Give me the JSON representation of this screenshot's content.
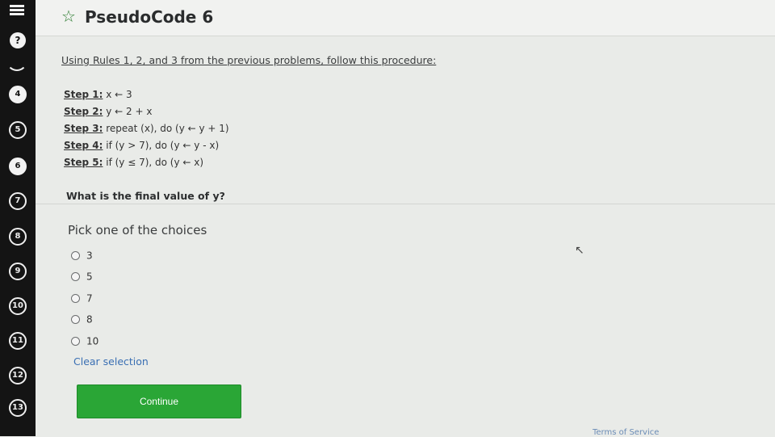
{
  "sidebar": {
    "help_label": "?",
    "items": [
      {
        "label": "4",
        "filled": true
      },
      {
        "label": "5",
        "filled": false
      },
      {
        "label": "6",
        "filled": true
      },
      {
        "label": "7",
        "filled": false
      },
      {
        "label": "8",
        "filled": false
      },
      {
        "label": "9",
        "filled": false
      },
      {
        "label": "10",
        "filled": false
      },
      {
        "label": "11",
        "filled": false
      },
      {
        "label": "12",
        "filled": false
      },
      {
        "label": "13",
        "filled": false
      }
    ]
  },
  "header": {
    "title": "PseudoCode 6",
    "star_icon": "star-outline-icon"
  },
  "problem": {
    "intro": "Using Rules 1, 2, and 3 from the previous problems, follow this procedure:",
    "steps": [
      {
        "label": "Step 1:",
        "text": " x ← 3"
      },
      {
        "label": "Step 2:",
        "text": " y ← 2 + x"
      },
      {
        "label": "Step 3:",
        "text": " repeat (x), do (y ← y + 1)"
      },
      {
        "label": "Step 4:",
        "text": " if (y > 7), do (y ← y - x)"
      },
      {
        "label": "Step 5:",
        "text": " if (y ≤ 7), do (y ← x)"
      }
    ],
    "question": "What is the final value of y?"
  },
  "answer": {
    "prompt": "Pick one of the choices",
    "choices": [
      "3",
      "5",
      "7",
      "8",
      "10"
    ],
    "clear_label": "Clear selection",
    "continue_label": "Continue"
  },
  "footer": {
    "terms_label": "Terms of Service"
  },
  "colors": {
    "accent_green": "#2aa636",
    "link_blue": "#3a6fb3",
    "sidebar_bg": "#141414"
  }
}
